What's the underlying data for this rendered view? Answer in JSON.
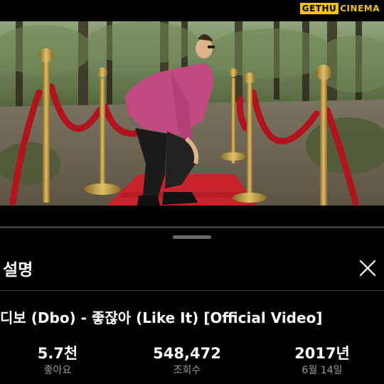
{
  "watermark": {
    "part_a": "GETHU",
    "part_b": "CINEMA"
  },
  "player": {
    "progress_fraction": 0.0
  },
  "description": {
    "header": "설명",
    "close_icon": "close-icon",
    "video_title": "디보 (Dbo) - 좋잖아 (Like It) [Official Video]"
  },
  "stats": {
    "likes": {
      "value": "5.7천",
      "label": "좋아요"
    },
    "views": {
      "value": "548,472",
      "label": "조회수"
    },
    "date": {
      "value": "2017년",
      "label": "6월 14일"
    }
  },
  "colors": {
    "background": "#000000",
    "text_primary": "#ffffff",
    "text_secondary": "#9a9a9a",
    "watermark_yellow": "#f5c400",
    "carpet_red": "#c8222a",
    "post_gold": "#c9a040"
  }
}
